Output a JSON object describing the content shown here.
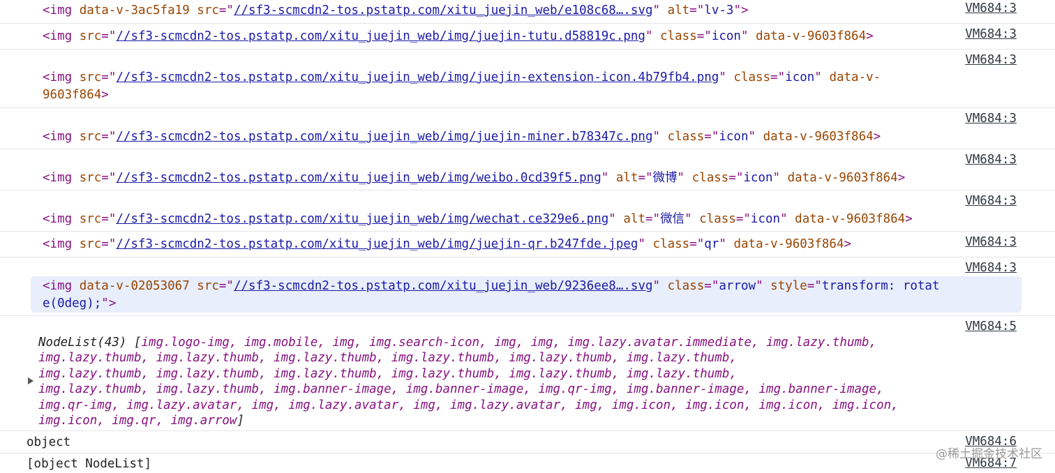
{
  "rows": [
    {
      "pre": "<img ",
      "attrs": [
        [
          "data-v-3ac5fa19",
          null
        ],
        [
          "src",
          "//sf3-scmcdn2-tos.pstatp.com/xitu_juejin_web/e108c68….svg",
          true
        ],
        [
          "alt",
          "lv-3"
        ]
      ],
      "source": "VM684:3"
    },
    {
      "pre": "<img ",
      "attrs": [
        [
          "src",
          "//sf3-scmcdn2-tos.pstatp.com/xitu_juejin_web/img/juejin-tutu.d58819c.png",
          true
        ],
        [
          "class",
          "icon"
        ],
        [
          "data-v-9603f864",
          null
        ]
      ],
      "source": "VM684:3"
    },
    {
      "source": "VM684:3"
    },
    {
      "source": "VM684:3"
    },
    {
      "source": "VM684:3"
    },
    {
      "source": "VM684:3"
    },
    {
      "source": "VM684:3"
    },
    {
      "source": "VM684:3"
    },
    {
      "source": "VM684:5"
    },
    {
      "source": "VM684:6"
    },
    {
      "source": "VM684:7"
    }
  ],
  "lines": {
    "r1": "data-v-3ac5fa19",
    "r1_url": "//sf3-scmcdn2-tos.pstatp.com/xitu_juejin_web/e108c68….svg",
    "r1_alt": "lv-3",
    "r2_url": "//sf3-scmcdn2-tos.pstatp.com/xitu_juejin_web/img/juejin-tutu.d58819c.png",
    "r3_url": "//sf3-scmcdn2-tos.pstatp.com/xitu_juejin_web/img/juejin-extension-icon.4b79fb4.png",
    "r3_tail": "9603f864",
    "r4_url": "//sf3-scmcdn2-tos.pstatp.com/xitu_juejin_web/img/juejin-miner.b78347c.png",
    "r5_url": "//sf3-scmcdn2-tos.pstatp.com/xitu_juejin_web/img/weibo.0cd39f5.png",
    "r5_alt": "微博",
    "r6_url": "//sf3-scmcdn2-tos.pstatp.com/xitu_juejin_web/img/wechat.ce329e6.png",
    "r6_alt": "微信",
    "r7_url": "//sf3-scmcdn2-tos.pstatp.com/xitu_juejin_web/img/juejin-qr.b247fde.jpeg",
    "r7_class": "qr",
    "r8_attr": "data-v-02053067",
    "r8_url": "//sf3-scmcdn2-tos.pstatp.com/xitu_juejin_web/9236ee8….svg",
    "r8_class": "arrow",
    "r8_style1": "transform: rotat",
    "r8_style2": "e(0deg);",
    "nodelist_label": "NodeList(43)",
    "nl1": "img.logo-img, img.mobile, img, img.search-icon, img, img, img.lazy.avatar.immediate, img.lazy.thumb,",
    "nl2": "img.lazy.thumb, img.lazy.thumb, img.lazy.thumb, img.lazy.thumb, img.lazy.thumb, img.lazy.thumb,",
    "nl3": "img.lazy.thumb, img.lazy.thumb, img.lazy.thumb, img.lazy.thumb, img.lazy.thumb, img.lazy.thumb,",
    "nl4": "img.lazy.thumb, img.lazy.thumb, img.banner-image, img.banner-image, img.qr-img, img.banner-image, img.banner-image,",
    "nl5": "img.qr-img, img.lazy.avatar, img, img.lazy.avatar, img, img.lazy.avatar, img, img.icon, img.icon, img.icon, img.icon,",
    "nl6": "img.icon, img.qr, img.arrow",
    "log_object": "object",
    "log_nodelist": "[object NodeList]",
    "icon_class": "icon",
    "data_v_9603": "data-v-9603f864",
    "data_v_prefix": "data-v-"
  },
  "sources": [
    "VM684:3",
    "VM684:3",
    "VM684:3",
    "VM684:3",
    "VM684:3",
    "VM684:3",
    "VM684:3",
    "VM684:3",
    "VM684:5",
    "VM684:6",
    "VM684:7"
  ],
  "watermark": "@稀土掘金技术社区"
}
